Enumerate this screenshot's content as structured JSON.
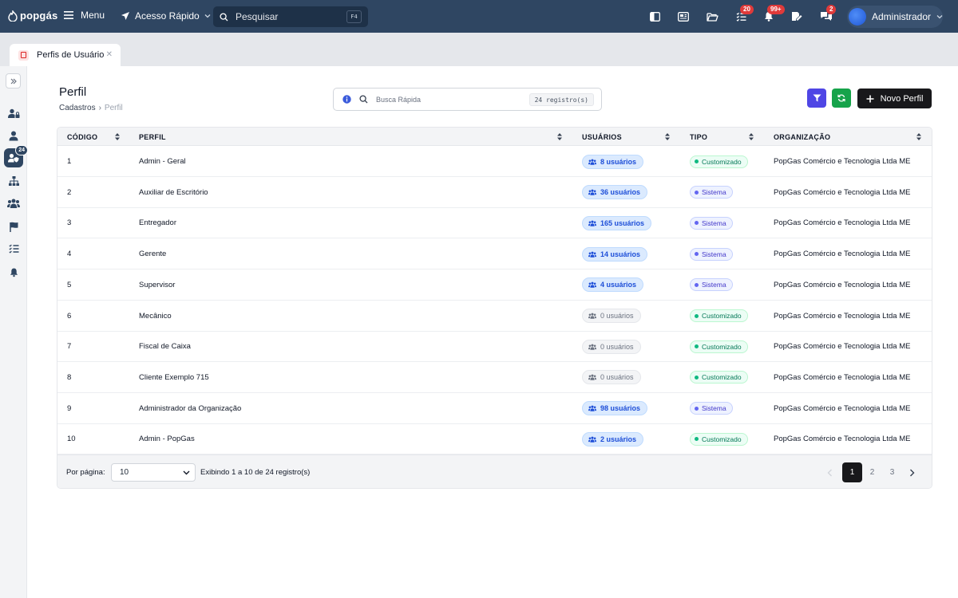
{
  "app": {
    "brand": "popgás",
    "menu_label": "Menu",
    "quick_access_label": "Acesso Rápido",
    "search_placeholder": "Pesquisar",
    "search_shortcut": "F4",
    "badges": {
      "tasks": "20",
      "notifications": "99+",
      "chat": "2"
    },
    "user_name": "Administrador"
  },
  "tabs": [
    {
      "label": "Perfis de Usuário"
    }
  ],
  "sidebar": {
    "active_badge": "24"
  },
  "page": {
    "title": "Perfil",
    "breadcrumb": [
      "Cadastros",
      "Perfil"
    ],
    "quick_search_placeholder": "Busca Rápida",
    "record_count": "24 registro(s)",
    "new_button_label": "Novo Perfil"
  },
  "table": {
    "columns": [
      "CÓDIGO",
      "PERFIL",
      "USUÁRIOS",
      "TIPO",
      "ORGANIZAÇÃO"
    ],
    "rows": [
      {
        "code": "1",
        "profile": "Admin - Geral",
        "users": "8 usuários",
        "users_active": true,
        "type": "Customizado",
        "org": "PopGas Comércio e Tecnologia Ltda ME"
      },
      {
        "code": "2",
        "profile": "Auxiliar de Escritório",
        "users": "36 usuários",
        "users_active": true,
        "type": "Sistema",
        "org": "PopGas Comércio e Tecnologia Ltda ME"
      },
      {
        "code": "3",
        "profile": "Entregador",
        "users": "165 usuários",
        "users_active": true,
        "type": "Sistema",
        "org": "PopGas Comércio e Tecnologia Ltda ME"
      },
      {
        "code": "4",
        "profile": "Gerente",
        "users": "14 usuários",
        "users_active": true,
        "type": "Sistema",
        "org": "PopGas Comércio e Tecnologia Ltda ME"
      },
      {
        "code": "5",
        "profile": "Supervisor",
        "users": "4 usuários",
        "users_active": true,
        "type": "Sistema",
        "org": "PopGas Comércio e Tecnologia Ltda ME"
      },
      {
        "code": "6",
        "profile": "Mecânico",
        "users": "0 usuários",
        "users_active": false,
        "type": "Customizado",
        "org": "PopGas Comércio e Tecnologia Ltda ME"
      },
      {
        "code": "7",
        "profile": "Fiscal de Caixa",
        "users": "0 usuários",
        "users_active": false,
        "type": "Customizado",
        "org": "PopGas Comércio e Tecnologia Ltda ME"
      },
      {
        "code": "8",
        "profile": "Cliente Exemplo 715",
        "users": "0 usuários",
        "users_active": false,
        "type": "Customizado",
        "org": "PopGas Comércio e Tecnologia Ltda ME"
      },
      {
        "code": "9",
        "profile": "Administrador da Organização",
        "users": "98 usuários",
        "users_active": true,
        "type": "Sistema",
        "org": "PopGas Comércio e Tecnologia Ltda ME"
      },
      {
        "code": "10",
        "profile": "Admin - PopGas",
        "users": "2 usuários",
        "users_active": true,
        "type": "Customizado",
        "org": "PopGas Comércio e Tecnologia Ltda ME"
      }
    ]
  },
  "footer": {
    "per_page_label": "Por página:",
    "per_page_value": "10",
    "showing_text": "Exibindo 1 a 10 de 24 registro(s)",
    "pages": [
      "1",
      "2",
      "3"
    ],
    "current_page": "1"
  },
  "colors": {
    "topbar": "#2f4662",
    "filter_button": "#4f46e5",
    "refresh_button": "#16a34a",
    "primary_button": "#18181b",
    "badge": "#e03a3a"
  }
}
